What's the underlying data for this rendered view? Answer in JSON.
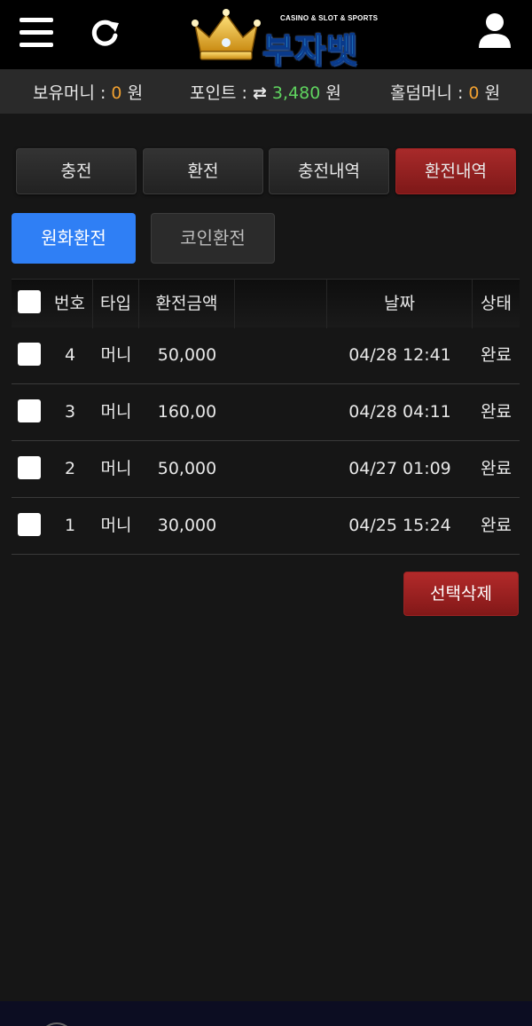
{
  "header": {
    "logo_tagline": "CASINO & SLOT & SPORTS",
    "logo_brand": "부자벳"
  },
  "balance": {
    "money_label": "보유머니 :",
    "money_value": "0",
    "money_unit": "원",
    "point_label": "포인트 :",
    "point_value": "3,480",
    "point_unit": "원",
    "holdem_label": "홀덤머니 :",
    "holdem_value": "0",
    "holdem_unit": "원"
  },
  "tabs": [
    {
      "label": "충전"
    },
    {
      "label": "환전"
    },
    {
      "label": "충전내역"
    },
    {
      "label": "환전내역"
    }
  ],
  "subtabs": [
    {
      "label": "원화환전"
    },
    {
      "label": "코인환전"
    }
  ],
  "table": {
    "columns": [
      "번호",
      "타입",
      "환전금액",
      "",
      "날짜",
      "상태"
    ],
    "rows": [
      {
        "no": "4",
        "type": "머니",
        "amount": "50,000",
        "date": "04/28 12:41",
        "status": "완료"
      },
      {
        "no": "3",
        "type": "머니",
        "amount": "160,00",
        "date": "04/28 04:11",
        "status": "완료"
      },
      {
        "no": "2",
        "type": "머니",
        "amount": "50,000",
        "date": "04/27 01:09",
        "status": "완료"
      },
      {
        "no": "1",
        "type": "머니",
        "amount": "30,000",
        "date": "04/25 15:24",
        "status": "완료"
      }
    ]
  },
  "delete_button": "선택삭제",
  "colors": {
    "accent_red": "#9a2222",
    "accent_blue": "#2f7ff5",
    "orange": "#f0a030",
    "green": "#5fd35f"
  },
  "icons": {
    "menu": "hamburger-menu-icon",
    "refresh": "refresh-icon",
    "user": "user-icon",
    "exchange": "exchange-arrows-icon"
  }
}
